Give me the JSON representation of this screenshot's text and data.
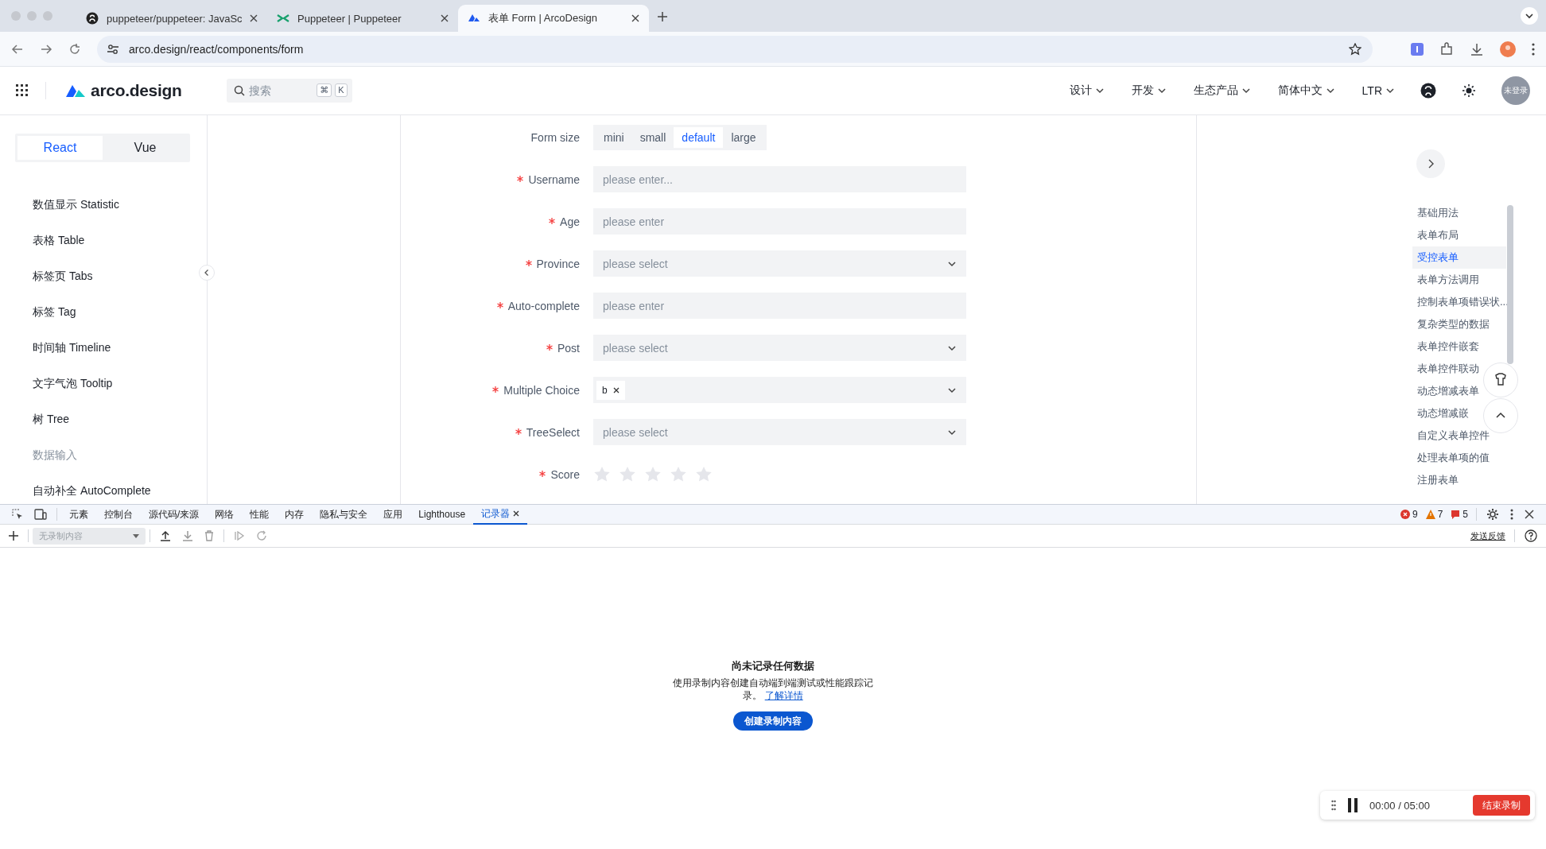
{
  "browser": {
    "tabs": [
      {
        "title": "puppeteer/puppeteer: JavaSc",
        "kind": "github",
        "selected": false
      },
      {
        "title": "Puppeteer | Puppeteer",
        "kind": "puppeteer",
        "selected": false
      },
      {
        "title": "表单 Form | ArcoDesign",
        "kind": "arco",
        "selected": true
      }
    ],
    "address": "arco.design/react/components/form"
  },
  "header": {
    "logo": "arco.design",
    "search": {
      "placeholder": "搜索",
      "keys": [
        "⌘",
        "K"
      ]
    },
    "nav": [
      {
        "label": "设计"
      },
      {
        "label": "开发"
      },
      {
        "label": "生态产品"
      },
      {
        "label": "简体中文"
      },
      {
        "label": "LTR"
      }
    ],
    "avatar": "未登录"
  },
  "sidebar": {
    "frameworks": [
      {
        "label": "React",
        "selected": true
      },
      {
        "label": "Vue",
        "selected": false
      }
    ],
    "items": [
      {
        "label": "数值显示 Statistic",
        "kind": "link"
      },
      {
        "label": "表格 Table",
        "kind": "link"
      },
      {
        "label": "标签页 Tabs",
        "kind": "link"
      },
      {
        "label": "标签 Tag",
        "kind": "link"
      },
      {
        "label": "时间轴 Timeline",
        "kind": "link"
      },
      {
        "label": "文字气泡 Tooltip",
        "kind": "link"
      },
      {
        "label": "树 Tree",
        "kind": "link"
      },
      {
        "label": "数据输入",
        "kind": "group"
      },
      {
        "label": "自动补全 AutoComplete",
        "kind": "link"
      }
    ]
  },
  "form": {
    "size": {
      "label": "Form size",
      "options": [
        {
          "label": "mini",
          "selected": false
        },
        {
          "label": "small",
          "selected": false
        },
        {
          "label": "default",
          "selected": true
        },
        {
          "label": "large",
          "selected": false
        }
      ]
    },
    "fields": [
      {
        "label": "Username",
        "required": true,
        "kind": "input",
        "placeholder": "please enter..."
      },
      {
        "label": "Age",
        "required": true,
        "kind": "input",
        "placeholder": "please enter"
      },
      {
        "label": "Province",
        "required": true,
        "kind": "select",
        "placeholder": "please select"
      },
      {
        "label": "Auto-complete",
        "required": true,
        "kind": "input",
        "placeholder": "please enter"
      },
      {
        "label": "Post",
        "required": true,
        "kind": "select",
        "placeholder": "please select"
      },
      {
        "label": "Multiple Choice",
        "required": true,
        "kind": "multi",
        "tags": [
          "b"
        ]
      },
      {
        "label": "TreeSelect",
        "required": true,
        "kind": "select",
        "placeholder": "please select"
      },
      {
        "label": "Score",
        "required": true,
        "kind": "rate",
        "stars": 0
      }
    ]
  },
  "toc": {
    "items": [
      {
        "label": "基础用法",
        "selected": false
      },
      {
        "label": "表单布局",
        "selected": false
      },
      {
        "label": "受控表单",
        "selected": true
      },
      {
        "label": "表单方法调用",
        "selected": false
      },
      {
        "label": "控制表单项错误状...",
        "selected": false
      },
      {
        "label": "复杂类型的数据",
        "selected": false
      },
      {
        "label": "表单控件嵌套",
        "selected": false
      },
      {
        "label": "表单控件联动",
        "selected": false
      },
      {
        "label": "动态增减表单",
        "selected": false
      },
      {
        "label": "动态增减嵌",
        "selected": false
      },
      {
        "label": "自定义表单控件",
        "selected": false
      },
      {
        "label": "处理表单项的值",
        "selected": false
      },
      {
        "label": "注册表单",
        "selected": false
      }
    ]
  },
  "devtools": {
    "tabs": [
      {
        "label": "元素",
        "selected": false
      },
      {
        "label": "控制台",
        "selected": false
      },
      {
        "label": "源代码/来源",
        "selected": false
      },
      {
        "label": "网络",
        "selected": false
      },
      {
        "label": "性能",
        "selected": false
      },
      {
        "label": "内存",
        "selected": false
      },
      {
        "label": "隐私与安全",
        "selected": false
      },
      {
        "label": "应用",
        "selected": false
      },
      {
        "label": "Lighthouse",
        "selected": false
      },
      {
        "label": "记录器",
        "selected": true
      }
    ],
    "counts": [
      {
        "kind": "error",
        "value": "9"
      },
      {
        "kind": "warning",
        "value": "7"
      },
      {
        "kind": "issue",
        "value": "5"
      }
    ],
    "recording_select": {
      "value": "无录制内容",
      "disabled": true
    },
    "feedback": "发送反馈",
    "empty": {
      "title": "尚未记录任何数据",
      "text": "使用录制内容创建自动端到端测试或性能跟踪记录。",
      "link": "了解详情",
      "button": "创建录制内容"
    },
    "recorder": {
      "time": "00:00 / 05:00",
      "stop": "结束录制"
    }
  }
}
